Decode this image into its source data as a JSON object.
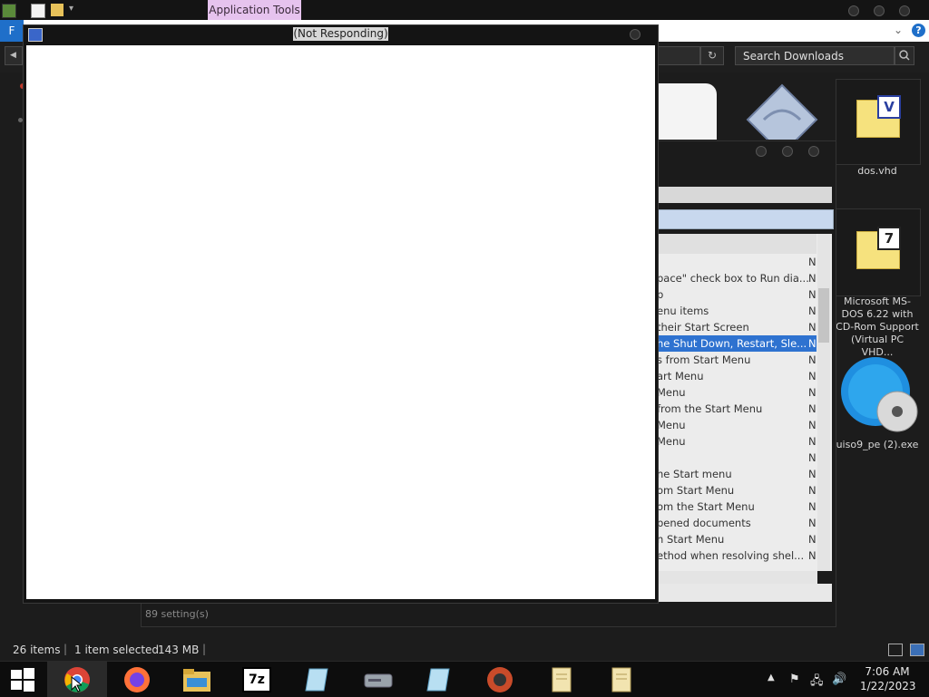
{
  "explorer": {
    "ribbon_contextual_tab": "Application Tools",
    "file_tab": "F",
    "search_placeholder": "Search Downloads",
    "status": {
      "item_count": "26 items",
      "selection": "1 item selected",
      "selection_size": "143 MB"
    },
    "files": [
      {
        "name": "dos.vhd",
        "icon": "vhd-file-icon"
      },
      {
        "name": "Microsoft MS-DOS 6.22 with CD-Rom Support (Virtual PC VHD...",
        "icon": "7z-archive-icon"
      },
      {
        "name": "uiso9_pe (2).exe",
        "icon": "ultraiso-icon"
      }
    ]
  },
  "hung_window": {
    "title": "(Not Responding)"
  },
  "policy_editor": {
    "settings_count": "89 setting(s)",
    "rows": [
      {
        "text": "",
        "state": "N"
      },
      {
        "text": "pace\" check box to Run dia...",
        "state": "N"
      },
      {
        "text": "p",
        "state": "N"
      },
      {
        "text": "enu items",
        "state": "N"
      },
      {
        "text": "their Start Screen",
        "state": "N"
      },
      {
        "text": "he Shut Down, Restart, Sle...",
        "state": "N",
        "selected": true
      },
      {
        "text": "s from Start Menu",
        "state": "N"
      },
      {
        "text": "art Menu",
        "state": "N"
      },
      {
        "text": "Menu",
        "state": "N"
      },
      {
        "text": "from the Start Menu",
        "state": "N"
      },
      {
        "text": "Menu",
        "state": "N"
      },
      {
        "text": "Menu",
        "state": "N"
      },
      {
        "text": "",
        "state": "N"
      },
      {
        "text": "he Start menu",
        "state": "N"
      },
      {
        "text": "om Start Menu",
        "state": "N"
      },
      {
        "text": "om the Start Menu",
        "state": "N"
      },
      {
        "text": "pened documents",
        "state": "N"
      },
      {
        "text": "n Start Menu",
        "state": "N"
      },
      {
        "text": "ethod when resolving shel...",
        "state": "N"
      }
    ]
  },
  "taskbar": {
    "apps": [
      {
        "name": "chrome-icon",
        "active": true
      },
      {
        "name": "firefox-icon"
      },
      {
        "name": "file-explorer-icon"
      },
      {
        "name": "7zip-icon",
        "label": "7z"
      },
      {
        "name": "notepad-icon"
      },
      {
        "name": "drive-icon"
      },
      {
        "name": "notepad-icon"
      },
      {
        "name": "bird-app-icon"
      },
      {
        "name": "scroll-icon"
      },
      {
        "name": "scroll-icon"
      }
    ],
    "clock": {
      "time": "7:06 AM",
      "date": "1/22/2023"
    }
  },
  "colors": {
    "selection": "#2e72d0",
    "contextual_tab": "#e6c3ee",
    "taskbar": "#0d0d0d"
  }
}
